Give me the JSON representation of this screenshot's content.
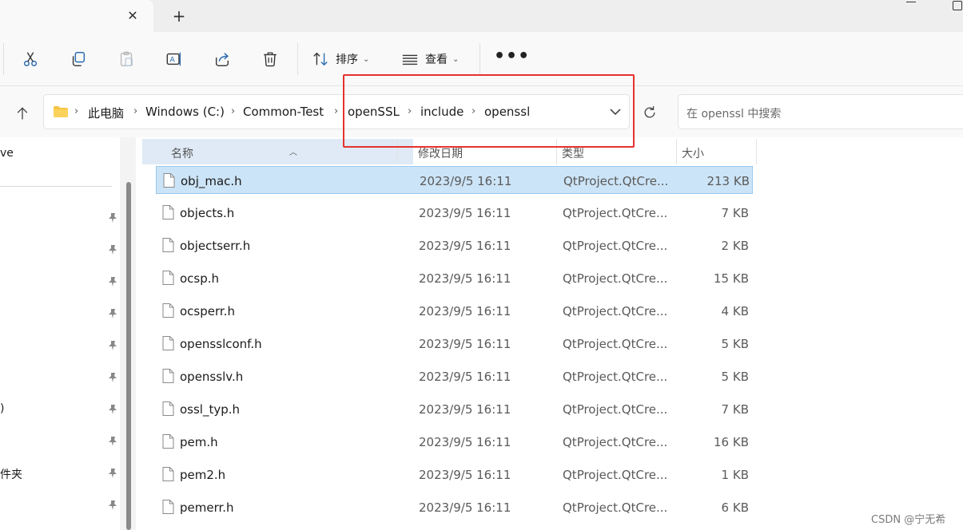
{
  "toolbar": {
    "sort_label": "排序",
    "view_label": "查看",
    "more_label": "•••"
  },
  "tabstrip": {
    "close_glyph": "✕",
    "add_glyph": "+"
  },
  "address": {
    "crumbs": [
      "此电脑",
      "Windows (C:)",
      "Common-Test",
      "openSSL",
      "include",
      "openssl"
    ],
    "separator": "›"
  },
  "search": {
    "placeholder": "在 openssl 中搜索"
  },
  "nav": {
    "item_partial_1": "ve",
    "item_partial_2": ")",
    "item_partial_3": "件夹"
  },
  "columns": {
    "name": "名称",
    "date": "修改日期",
    "type": "类型",
    "size": "大小"
  },
  "files": [
    {
      "name": "obj_mac.h",
      "date": "2023/9/5 16:11",
      "type": "QtProject.QtCre...",
      "size": "213 KB",
      "selected": true
    },
    {
      "name": "objects.h",
      "date": "2023/9/5 16:11",
      "type": "QtProject.QtCre...",
      "size": "7 KB"
    },
    {
      "name": "objectserr.h",
      "date": "2023/9/5 16:11",
      "type": "QtProject.QtCre...",
      "size": "2 KB"
    },
    {
      "name": "ocsp.h",
      "date": "2023/9/5 16:11",
      "type": "QtProject.QtCre...",
      "size": "15 KB"
    },
    {
      "name": "ocsperr.h",
      "date": "2023/9/5 16:11",
      "type": "QtProject.QtCre...",
      "size": "4 KB"
    },
    {
      "name": "opensslconf.h",
      "date": "2023/9/5 16:11",
      "type": "QtProject.QtCre...",
      "size": "5 KB"
    },
    {
      "name": "opensslv.h",
      "date": "2023/9/5 16:11",
      "type": "QtProject.QtCre...",
      "size": "5 KB"
    },
    {
      "name": "ossl_typ.h",
      "date": "2023/9/5 16:11",
      "type": "QtProject.QtCre...",
      "size": "7 KB"
    },
    {
      "name": "pem.h",
      "date": "2023/9/5 16:11",
      "type": "QtProject.QtCre...",
      "size": "16 KB"
    },
    {
      "name": "pem2.h",
      "date": "2023/9/5 16:11",
      "type": "QtProject.QtCre...",
      "size": "1 KB"
    },
    {
      "name": "pemerr.h",
      "date": "2023/9/5 16:11",
      "type": "QtProject.QtCre...",
      "size": "6 KB"
    }
  ],
  "watermark": "CSDN @宁无希",
  "colors": {
    "selection": "#cce4f7",
    "annotation": "#e5322d",
    "folder": "#f6c445"
  }
}
